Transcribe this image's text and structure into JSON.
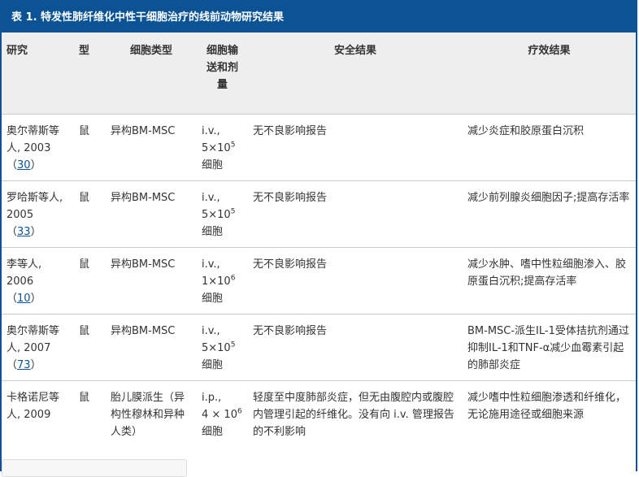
{
  "title": "表 1. 特发性肺纤维化中性干细胞治疗的线前动物研究结果",
  "headers": [
    "研究",
    "型",
    "细胞类型",
    "细胞输送和剂量",
    "安全结果",
    "疗效结果"
  ],
  "rows": [
    {
      "study": "奥尔蒂斯等人, 2003",
      "ref": "30",
      "species": "鼠",
      "cell": "异构BM-MSC",
      "route": "i.v.,",
      "dose_base": "5×10",
      "dose_exp": "5",
      "dose_unit": "细胞",
      "safety": "无不良影响报告",
      "efficacy": "减少炎症和胶原蛋白沉积"
    },
    {
      "study": "罗哈斯等人, 2005",
      "ref": "33",
      "species": "鼠",
      "cell": "异构BM-MSC",
      "route": "i.v.,",
      "dose_base": "5×10",
      "dose_exp": "5",
      "dose_unit": "细胞",
      "safety": "无不良影响报告",
      "efficacy": "减少前列腺炎细胞因子;提高存活率"
    },
    {
      "study": "李等人, 2006",
      "ref": "10",
      "species": "鼠",
      "cell": "异构BM-MSC",
      "route": "i.v.,",
      "dose_base": "1×10",
      "dose_exp": "6",
      "dose_unit": "细胞",
      "safety": "无不良影响报告",
      "efficacy": "减少水肿、嗜中性粒细胞渗入、胶原蛋白沉积;提高存活率"
    },
    {
      "study": "奥尔蒂斯等人, 2007",
      "ref": "73",
      "species": "鼠",
      "cell": "异构BM-MSC",
      "route": "i.v.,",
      "dose_base": "5×10",
      "dose_exp": "5",
      "dose_unit": "细胞",
      "safety": "无不良影响报告",
      "efficacy": "BM-MSC-派生IL-1受体拮抗剂通过抑制IL-1和TNF-α减少血霉素引起的肺部炎症"
    },
    {
      "study": "卡格诺尼等人, 2009",
      "ref": "",
      "species": "鼠",
      "cell": "胎儿膜派生（异构性穆林和异种人类）",
      "route": "i.p.,",
      "dose_base": "4 × 10",
      "dose_exp": "6",
      "dose_unit": "细胞",
      "safety": "轻度至中度肺部炎症，但无由腹腔内或腹腔内管理引起的纤维化。没有向 i.v. 管理报告的不利影响",
      "efficacy": "减少嗜中性粒细胞渗透和纤维化，无论施用途径或细胞来源"
    }
  ]
}
